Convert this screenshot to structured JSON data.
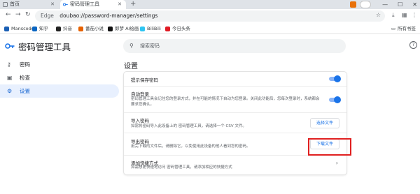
{
  "browser": {
    "tabs": [
      {
        "label": "首页"
      },
      {
        "label": "密码管理工具"
      }
    ],
    "new_tab": "+",
    "window_controls": [
      "—",
      "☐",
      "✕"
    ],
    "nav": {
      "back": "←",
      "forward": "→",
      "reload": "↻"
    },
    "address": {
      "chip": "Edge",
      "url": "doubao://password-manager/settings"
    },
    "bookmarks": [
      {
        "label": "Manscode",
        "color": "#1a5fb4"
      },
      {
        "label": "知乎",
        "color": "#0a66c2"
      },
      {
        "label": "抖音",
        "color": "#222222"
      },
      {
        "label": "番茄小说",
        "color": "#e66100"
      },
      {
        "label": "即梦 AI绘画",
        "color": "#111111"
      },
      {
        "label": "BiliBili",
        "color": "#2ec4f1"
      },
      {
        "label": "今日头条",
        "color": "#e01b24"
      }
    ],
    "bookmarks_right": "所有书签"
  },
  "app": {
    "title": "密码管理工具",
    "search_placeholder": "搜索密码",
    "help": "?",
    "sidebar": [
      {
        "label": "密码",
        "icon": "key-icon",
        "active": false
      },
      {
        "label": "检查",
        "icon": "check-icon",
        "active": false
      },
      {
        "label": "设置",
        "icon": "gear-icon",
        "active": true
      }
    ],
    "section_title": "设置",
    "settings": [
      {
        "title": "提示保存密码",
        "subtitle": "",
        "control": "toggle",
        "enabled": true
      },
      {
        "title": "自动登录",
        "subtitle": "密码管理工具会记住您的登录方式，并在可能的情况下自动为您登录。关闭此功能后，您每次登录时，系统都会要求您确认。",
        "control": "toggle",
        "enabled": true
      },
      {
        "title": "导入密码",
        "subtitle": "如需将密码导入此设备上的 密码管理工具，请选择一个 CSV 文件。",
        "control": "button",
        "button_label": "选择文件"
      },
      {
        "title": "导出密码",
        "subtitle": "用完下载的文件后，请删除它，以免使用此设备的他人看到您的密码。",
        "control": "button",
        "button_label": "下载文件"
      },
      {
        "title": "添加快捷方式",
        "subtitle": "如需想更快速地访问 密码管理工具，请添加相应的快捷方式",
        "control": "chevron"
      }
    ],
    "accent_color": "#1a73e8",
    "highlight_color": "#e02020"
  }
}
